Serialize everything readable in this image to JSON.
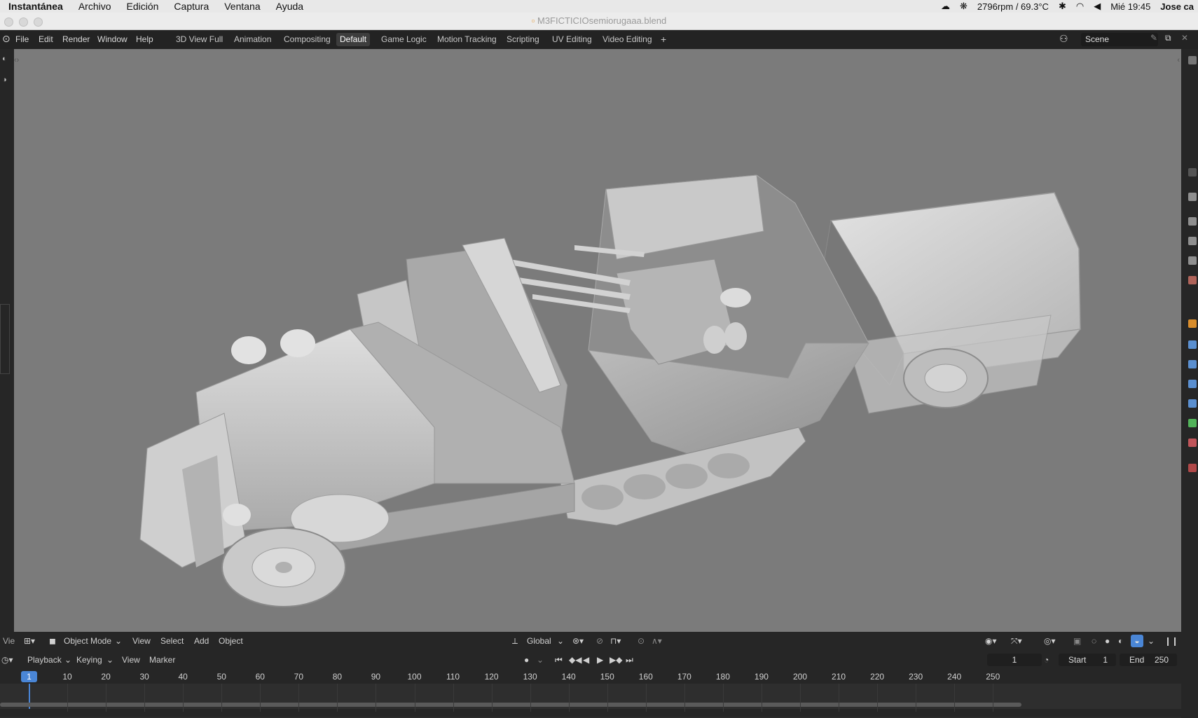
{
  "macos": {
    "app": "Instantánea",
    "menus": [
      "Archivo",
      "Edición",
      "Captura",
      "Ventana",
      "Ayuda"
    ],
    "status": {
      "fan": "2796rpm / 69.3°C",
      "clock": "Mié 19:45",
      "user": "Jose ca"
    }
  },
  "window": {
    "title": "M3FICTICIOsemiorugaaa.blend"
  },
  "topbar": {
    "menus": [
      "File",
      "Edit",
      "Render",
      "Window",
      "Help"
    ],
    "workspaces": [
      "3D View Full",
      "Animation",
      "Compositing",
      "Default",
      "Game Logic",
      "Motion Tracking",
      "Scripting",
      "UV Editing",
      "Video Editing"
    ],
    "active_workspace": "Default",
    "add_tab": "+",
    "scene": "Scene"
  },
  "viewport_header": {
    "editor_cut": "Vie",
    "mode": "Object Mode",
    "menus": [
      "View",
      "Select",
      "Add",
      "Object"
    ],
    "orientation": "Global"
  },
  "timeline_header": {
    "menus": [
      "Playback",
      "Keying",
      "View",
      "Marker"
    ],
    "current_frame": "1",
    "start_label": "Start",
    "start_value": "1",
    "end_label": "End",
    "end_value": "250"
  },
  "timeline": {
    "current_frame": "1",
    "ticks": [
      "10",
      "20",
      "30",
      "40",
      "50",
      "60",
      "70",
      "80",
      "90",
      "100",
      "110",
      "120",
      "130",
      "140",
      "150",
      "160",
      "170",
      "180",
      "190",
      "200",
      "210",
      "220",
      "230",
      "240",
      "250"
    ]
  },
  "colors": {
    "accent": "#4a86d6",
    "viewport_bg": "#7b7b7b",
    "panel_bg": "#262626"
  }
}
